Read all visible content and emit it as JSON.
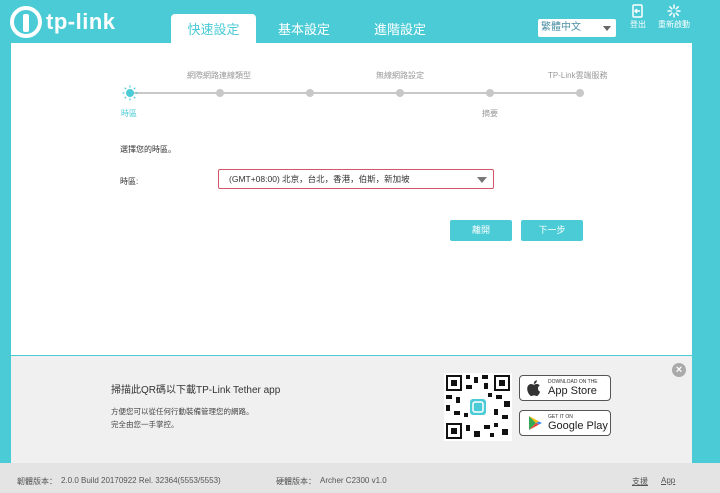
{
  "header": {
    "logo_text": "tp-link",
    "tabs": [
      {
        "label": "快速設定"
      },
      {
        "label": "基本設定"
      },
      {
        "label": "進階設定"
      }
    ],
    "language": "繁體中文",
    "logout_label": "登出",
    "reboot_label": "重新啟動"
  },
  "wizard": {
    "steps_top": [
      "網際網路連線類型",
      "無線網路設定",
      "TP-Link雲端服務"
    ],
    "steps_bottom": [
      "時區",
      "摘要"
    ],
    "prompt": "選擇您的時區。",
    "timezone_label": "時區:",
    "timezone_value": "(GMT+08:00) 北京，台北，香港，伯斯，新加坡",
    "exit_button": "離開",
    "next_button": "下一步"
  },
  "promo": {
    "title": "掃描此QR碼以下載TP-Link Tether app",
    "line1": "方便您可以從任何行動裝備管理您的網路。",
    "line2": "完全由您一手掌控。",
    "appstore_small": "DOWNLOAD ON THE",
    "appstore_big": "App Store",
    "googleplay_small": "GET IT ON",
    "googleplay_big": "Google Play",
    "close": "×"
  },
  "footer": {
    "firmware_label": "韌體版本：",
    "firmware_value": "2.0.0 Build 20170922 Rel. 32364(5553/5553)",
    "hardware_label": "硬體版本：",
    "hardware_value": "Archer C2300 v1.0",
    "support_link": "支援",
    "app_link": "App"
  },
  "colors": {
    "accent": "#4acbd6",
    "error_border": "#d4566a"
  }
}
